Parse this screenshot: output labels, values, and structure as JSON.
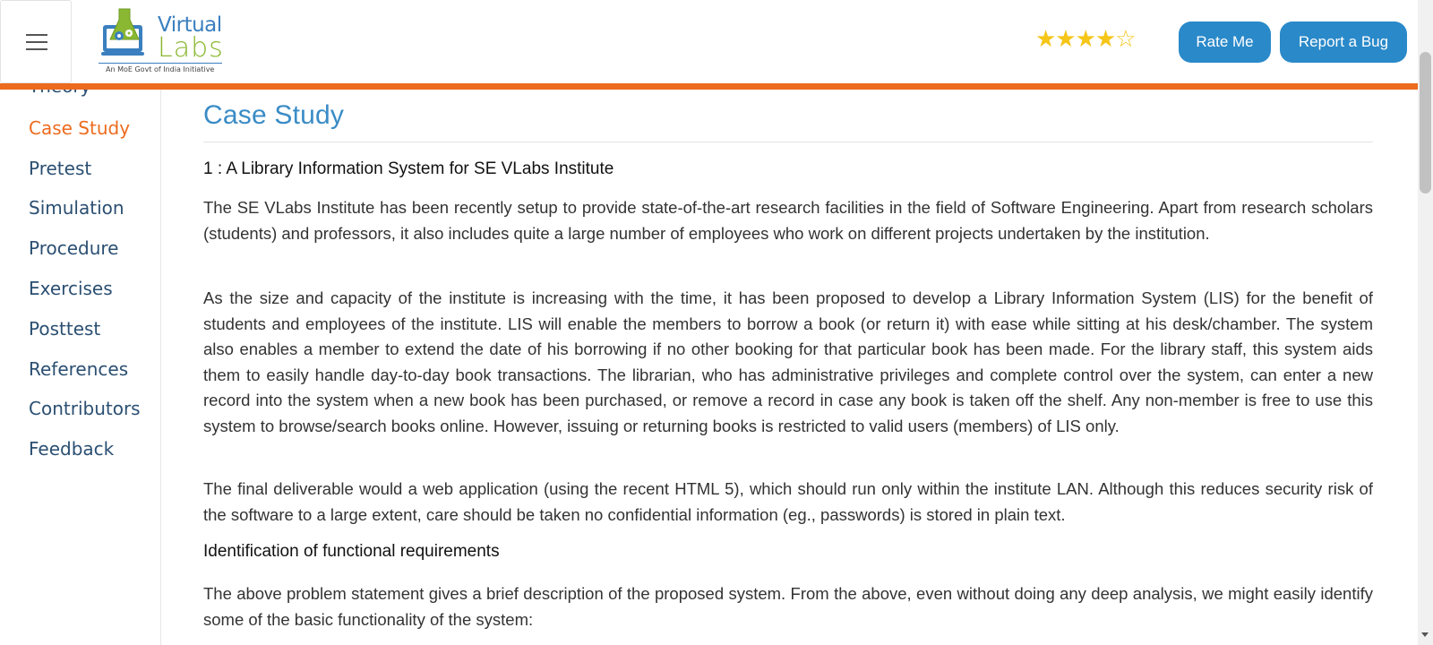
{
  "header": {
    "logo_word1": "Virtual",
    "logo_word2": "Labs",
    "logo_tagline": "An MoE Govt of India Initiative",
    "rating": {
      "filled": 4,
      "total": 5,
      "filled_glyph": "★★★★",
      "empty_glyph": "☆"
    },
    "rate_button": "Rate Me",
    "bug_button": "Report a Bug"
  },
  "sidebar": {
    "partial_item": "Theory",
    "items": [
      {
        "label": "Case Study",
        "active": true
      },
      {
        "label": "Pretest",
        "active": false
      },
      {
        "label": "Simulation",
        "active": false
      },
      {
        "label": "Procedure",
        "active": false
      },
      {
        "label": "Exercises",
        "active": false
      },
      {
        "label": "Posttest",
        "active": false
      },
      {
        "label": "References",
        "active": false
      },
      {
        "label": "Contributors",
        "active": false
      },
      {
        "label": "Feedback",
        "active": false
      }
    ]
  },
  "main": {
    "title": "Case Study",
    "subtitle": "1 : A Library Information System for SE VLabs Institute",
    "paragraph1": "The SE VLabs Institute has been recently setup to provide state-of-the-art research facilities in the field of Software Engineering. Apart from research scholars (students) and professors, it also includes quite a large number of employees who work on different projects undertaken by the institution.",
    "paragraph2": "As the size and capacity of the institute is increasing with the time, it has been proposed to develop a Library Information System (LIS) for the benefit of students and employees of the institute. LIS will enable the members to borrow a book (or return it) with ease while sitting at his desk/chamber. The system also enables a member to extend the date of his borrowing if no other booking for that particular book has been made. For the library staff, this system aids them to easily handle day-to-day book transactions. The librarian, who has administrative privileges and complete control over the system, can enter a new record into the system when a new book has been purchased, or remove a record in case any book is taken off the shelf. Any non-member is free to use this system to browse/search books online. However, issuing or returning books is restricted to valid users (members) of LIS only.",
    "paragraph3": "The final deliverable would a web application (using the recent HTML 5), which should run only within the institute LAN. Although this reduces security risk of the software to a large extent, care should be taken no confidential information (eg., passwords) is stored in plain text.",
    "section_heading": "Identification of functional requirements",
    "paragraph4": "The above problem statement gives a brief description of the proposed system. From the above, even without doing any deep analysis, we might easily identify some of the basic functionality of the system:"
  },
  "colors": {
    "accent_orange": "#ec6b1e",
    "button_blue": "#2a89c9",
    "title_blue": "#3a8cc6",
    "nav_text": "#2b4f72",
    "star_gold": "#f5c518"
  }
}
